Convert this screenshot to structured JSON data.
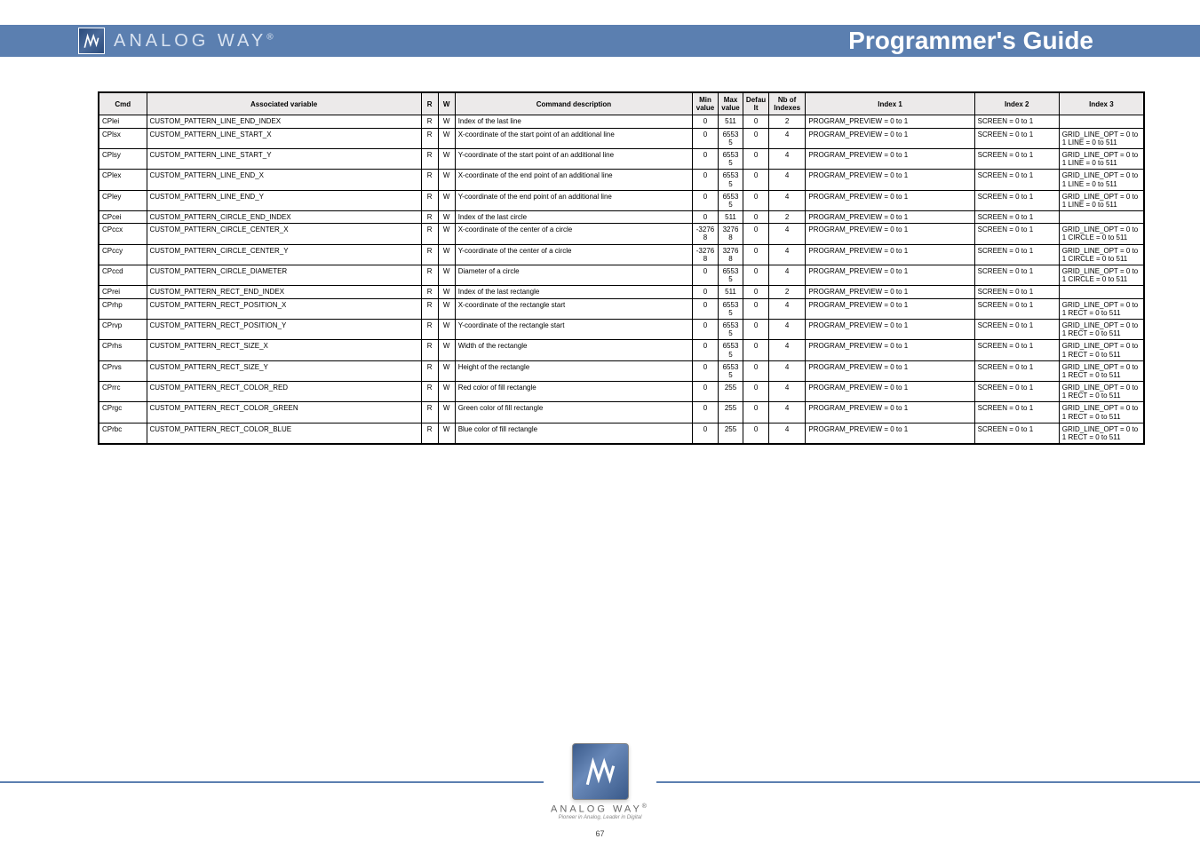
{
  "header": {
    "brand": "ANALOG WAY",
    "reg": "®",
    "title": "Programmer's Guide"
  },
  "footer": {
    "brand": "ANALOG WAY",
    "reg": "®",
    "tagline": "Pioneer in Analog, Leader in Digital",
    "page": "67"
  },
  "table": {
    "headers": {
      "cmd": "Cmd",
      "var": "Associated variable",
      "r": "R",
      "w": "W",
      "desc": "Command description",
      "min": "Min value",
      "max": "Max value",
      "def": "Default",
      "nbidx": "Nb of Indexes",
      "idx1": "Index 1",
      "idx2": "Index 2",
      "idx3": "Index 3"
    },
    "rows": [
      {
        "cmd": "CPlei",
        "var": "CUSTOM_PATTERN_LINE_END_INDEX",
        "r": "R",
        "w": "W",
        "desc": "Index of the last line",
        "min": "0",
        "max": "511",
        "def": "0",
        "nbidx": "2",
        "idx1": "PROGRAM_PREVIEW = 0 to 1",
        "idx2": "SCREEN = 0 to 1",
        "idx3": ""
      },
      {
        "cmd": "CPlsx",
        "var": "CUSTOM_PATTERN_LINE_START_X",
        "r": "R",
        "w": "W",
        "desc": "X-coordinate of the start point of an additional line",
        "min": "0",
        "max": "65535",
        "def": "0",
        "nbidx": "4",
        "idx1": "PROGRAM_PREVIEW = 0 to 1",
        "idx2": "SCREEN = 0 to 1",
        "idx3": "GRID_LINE_OPT = 0 to 1 LINE = 0 to 511"
      },
      {
        "cmd": "CPlsy",
        "var": "CUSTOM_PATTERN_LINE_START_Y",
        "r": "R",
        "w": "W",
        "desc": "Y-coordinate of the start point of an additional line",
        "min": "0",
        "max": "65535",
        "def": "0",
        "nbidx": "4",
        "idx1": "PROGRAM_PREVIEW = 0 to 1",
        "idx2": "SCREEN = 0 to 1",
        "idx3": "GRID_LINE_OPT = 0 to 1 LINE = 0 to 511"
      },
      {
        "cmd": "CPlex",
        "var": "CUSTOM_PATTERN_LINE_END_X",
        "r": "R",
        "w": "W",
        "desc": "X-coordinate of the end point of an additional line",
        "min": "0",
        "max": "65535",
        "def": "0",
        "nbidx": "4",
        "idx1": "PROGRAM_PREVIEW = 0 to 1",
        "idx2": "SCREEN = 0 to 1",
        "idx3": "GRID_LINE_OPT = 0 to 1 LINE = 0 to 511"
      },
      {
        "cmd": "CPley",
        "var": "CUSTOM_PATTERN_LINE_END_Y",
        "r": "R",
        "w": "W",
        "desc": "Y-coordinate of the end point of an additional line",
        "min": "0",
        "max": "65535",
        "def": "0",
        "nbidx": "4",
        "idx1": "PROGRAM_PREVIEW = 0 to 1",
        "idx2": "SCREEN = 0 to 1",
        "idx3": "GRID_LINE_OPT = 0 to 1 LINE = 0 to 511"
      },
      {
        "cmd": "CPcei",
        "var": "CUSTOM_PATTERN_CIRCLE_END_INDEX",
        "r": "R",
        "w": "W",
        "desc": "Index of the last circle",
        "min": "0",
        "max": "511",
        "def": "0",
        "nbidx": "2",
        "idx1": "PROGRAM_PREVIEW = 0 to 1",
        "idx2": "SCREEN = 0 to 1",
        "idx3": ""
      },
      {
        "cmd": "CPccx",
        "var": "CUSTOM_PATTERN_CIRCLE_CENTER_X",
        "r": "R",
        "w": "W",
        "desc": "X-coordinate of the center of a circle",
        "min": "-32768",
        "max": "32768",
        "def": "0",
        "nbidx": "4",
        "idx1": "PROGRAM_PREVIEW = 0 to 1",
        "idx2": "SCREEN = 0 to 1",
        "idx3": "GRID_LINE_OPT = 0 to 1 CIRCLE = 0 to 511"
      },
      {
        "cmd": "CPccy",
        "var": "CUSTOM_PATTERN_CIRCLE_CENTER_Y",
        "r": "R",
        "w": "W",
        "desc": "Y-coordinate of the center of a circle",
        "min": "-32768",
        "max": "32768",
        "def": "0",
        "nbidx": "4",
        "idx1": "PROGRAM_PREVIEW = 0 to 1",
        "idx2": "SCREEN = 0 to 1",
        "idx3": "GRID_LINE_OPT = 0 to 1 CIRCLE = 0 to 511"
      },
      {
        "cmd": "CPccd",
        "var": "CUSTOM_PATTERN_CIRCLE_DIAMETER",
        "r": "R",
        "w": "W",
        "desc": "Diameter of a circle",
        "min": "0",
        "max": "65535",
        "def": "0",
        "nbidx": "4",
        "idx1": "PROGRAM_PREVIEW = 0 to 1",
        "idx2": "SCREEN = 0 to 1",
        "idx3": "GRID_LINE_OPT = 0 to 1 CIRCLE = 0 to 511"
      },
      {
        "cmd": "CPrei",
        "var": "CUSTOM_PATTERN_RECT_END_INDEX",
        "r": "R",
        "w": "W",
        "desc": "Index of the last rectangle",
        "min": "0",
        "max": "511",
        "def": "0",
        "nbidx": "2",
        "idx1": "PROGRAM_PREVIEW = 0 to 1",
        "idx2": "SCREEN = 0 to 1",
        "idx3": ""
      },
      {
        "cmd": "CPrhp",
        "var": "CUSTOM_PATTERN_RECT_POSITION_X",
        "r": "R",
        "w": "W",
        "desc": "X-coordinate of the rectangle start",
        "min": "0",
        "max": "65535",
        "def": "0",
        "nbidx": "4",
        "idx1": "PROGRAM_PREVIEW = 0 to 1",
        "idx2": "SCREEN = 0 to 1",
        "idx3": "GRID_LINE_OPT = 0 to 1 RECT = 0 to 511"
      },
      {
        "cmd": "CPrvp",
        "var": "CUSTOM_PATTERN_RECT_POSITION_Y",
        "r": "R",
        "w": "W",
        "desc": "Y-coordinate of the rectangle start",
        "min": "0",
        "max": "65535",
        "def": "0",
        "nbidx": "4",
        "idx1": "PROGRAM_PREVIEW = 0 to 1",
        "idx2": "SCREEN = 0 to 1",
        "idx3": "GRID_LINE_OPT = 0 to 1 RECT = 0 to 511"
      },
      {
        "cmd": "CPrhs",
        "var": "CUSTOM_PATTERN_RECT_SIZE_X",
        "r": "R",
        "w": "W",
        "desc": "Width of the rectangle",
        "min": "0",
        "max": "65535",
        "def": "0",
        "nbidx": "4",
        "idx1": "PROGRAM_PREVIEW = 0 to 1",
        "idx2": "SCREEN = 0 to 1",
        "idx3": "GRID_LINE_OPT = 0 to 1 RECT = 0 to 511"
      },
      {
        "cmd": "CPrvs",
        "var": "CUSTOM_PATTERN_RECT_SIZE_Y",
        "r": "R",
        "w": "W",
        "desc": "Height of the rectangle",
        "min": "0",
        "max": "65535",
        "def": "0",
        "nbidx": "4",
        "idx1": "PROGRAM_PREVIEW = 0 to 1",
        "idx2": "SCREEN = 0 to 1",
        "idx3": "GRID_LINE_OPT = 0 to 1 RECT = 0 to 511"
      },
      {
        "cmd": "CPrrc",
        "var": "CUSTOM_PATTERN_RECT_COLOR_RED",
        "r": "R",
        "w": "W",
        "desc": "Red color of fill rectangle",
        "min": "0",
        "max": "255",
        "def": "0",
        "nbidx": "4",
        "idx1": "PROGRAM_PREVIEW = 0 to 1",
        "idx2": "SCREEN = 0 to 1",
        "idx3": "GRID_LINE_OPT = 0 to 1 RECT = 0 to 511"
      },
      {
        "cmd": "CPrgc",
        "var": "CUSTOM_PATTERN_RECT_COLOR_GREEN",
        "r": "R",
        "w": "W",
        "desc": "Green color of fill rectangle",
        "min": "0",
        "max": "255",
        "def": "0",
        "nbidx": "4",
        "idx1": "PROGRAM_PREVIEW = 0 to 1",
        "idx2": "SCREEN = 0 to 1",
        "idx3": "GRID_LINE_OPT = 0 to 1 RECT = 0 to 511"
      },
      {
        "cmd": "CPrbc",
        "var": "CUSTOM_PATTERN_RECT_COLOR_BLUE",
        "r": "R",
        "w": "W",
        "desc": "Blue color of fill rectangle",
        "min": "0",
        "max": "255",
        "def": "0",
        "nbidx": "4",
        "idx1": "PROGRAM_PREVIEW = 0 to 1",
        "idx2": "SCREEN = 0 to 1",
        "idx3": "GRID_LINE_OPT = 0 to 1 RECT = 0 to 511"
      }
    ]
  }
}
